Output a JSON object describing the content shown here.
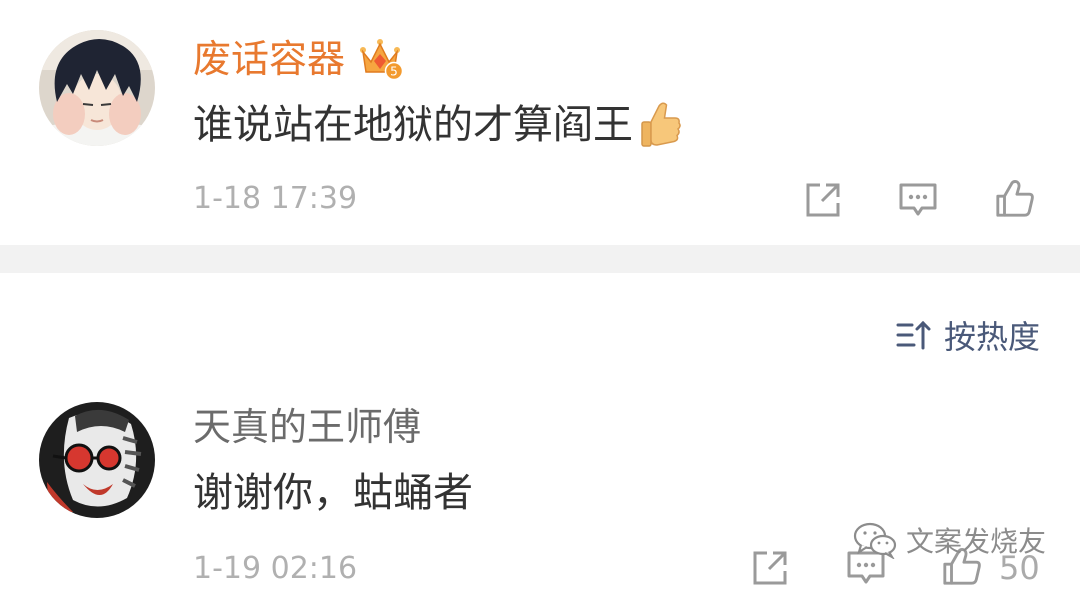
{
  "comments": [
    {
      "username": "废话容器",
      "badge": {
        "icon": "crown-badge-icon",
        "level": "5"
      },
      "text": "谁说站在地狱的才算阎王",
      "emoji": "thumbs-up-emoji-icon",
      "time": "1-18 17:39",
      "actions": [
        "share-icon",
        "comment-icon",
        "like-icon"
      ]
    },
    {
      "username": "天真的王师傅",
      "text": "谢谢你，蛄蛹者",
      "time": "1-19 02:16",
      "like_count": "50",
      "actions": [
        "share-icon",
        "comment-icon",
        "like-icon"
      ]
    }
  ],
  "sort": {
    "icon": "sort-icon",
    "label": "按热度"
  },
  "watermark": {
    "icon": "wechat-icon",
    "text": "文案发烧友"
  },
  "colors": {
    "vip_name": "#e8792f",
    "plain_name": "#6b6b6b",
    "body_text": "#333333",
    "meta_gray": "#b0b0b0",
    "icon_gray": "#9a9a9a",
    "sort_accent": "#4a5979",
    "separator": "#f2f2f2"
  }
}
